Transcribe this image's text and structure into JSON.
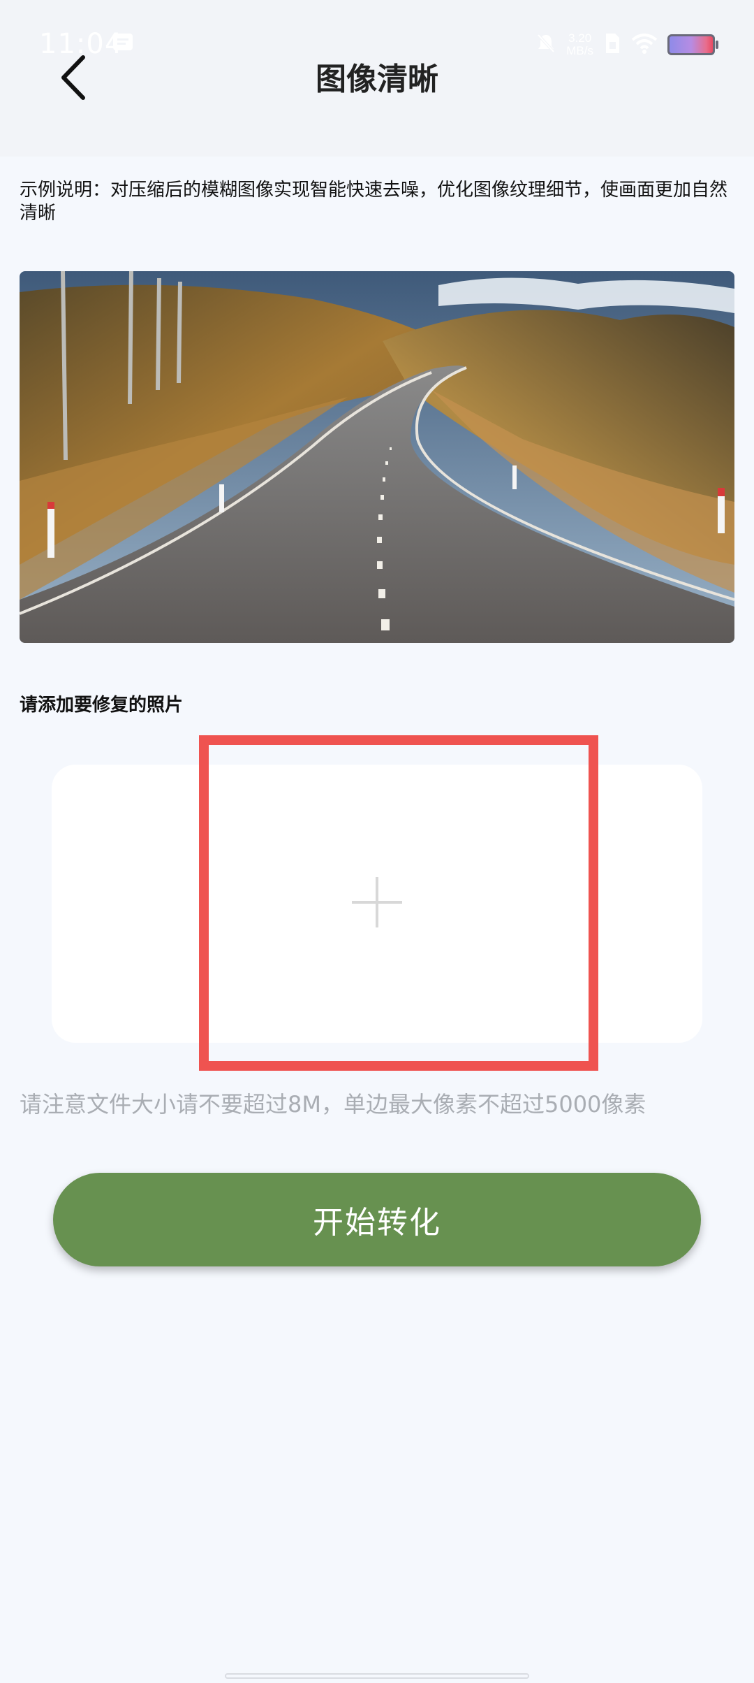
{
  "status_bar": {
    "time": "11:04",
    "network_speed_value": "3.20",
    "network_speed_unit": "MB/s",
    "icons": [
      "notification-icon",
      "mute-icon",
      "sim-icon",
      "wifi-icon",
      "battery-icon"
    ]
  },
  "header": {
    "title": "图像清晰",
    "back_icon": "back-arrow-icon"
  },
  "description": "示例说明：对压缩后的模糊图像实现智能快速去噪，优化图像纹理细节，使画面更加自然清晰",
  "upload": {
    "label": "请添加要修复的照片",
    "icon": "plus-icon",
    "note": "请注意文件大小请不要超过8M，单边最大像素不超过5000像素"
  },
  "actions": {
    "start_label": "开始转化"
  },
  "colors": {
    "accent": "#679150",
    "highlight_frame": "#ef5350",
    "background": "#f5f8fd"
  }
}
